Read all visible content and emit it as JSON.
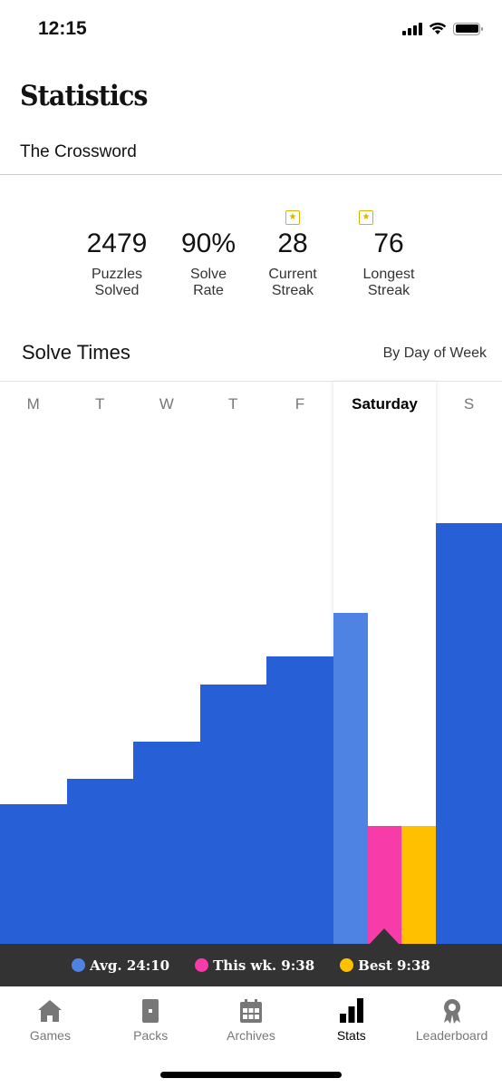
{
  "status_bar": {
    "time": "12:15"
  },
  "header": {
    "title": "Statistics",
    "subtitle": "The Crossword"
  },
  "stats": [
    {
      "value": "2479",
      "label_line1": "Puzzles",
      "label_line2": "Solved",
      "badge": false
    },
    {
      "value": "90%",
      "label_line1": "Solve",
      "label_line2": "Rate",
      "badge": false
    },
    {
      "value": "28",
      "label_line1": "Current",
      "label_line2": "Streak",
      "badge": true,
      "badge_icon": "star-icon"
    },
    {
      "value": "76",
      "label_line1": "Longest",
      "label_line2": "Streak",
      "badge": true,
      "badge_icon": "star-icon"
    }
  ],
  "solve_times": {
    "heading": "Solve Times",
    "view_selector": "By Day of Week"
  },
  "colors": {
    "avg": "#4f83e3",
    "bar": "#2760d6",
    "this_week": "#f73caa",
    "best": "#ffc000",
    "legend_bg": "#333333"
  },
  "chart_data": {
    "type": "bar",
    "title": "Solve Times",
    "subtitle": "By Day of Week",
    "categories": [
      "M",
      "T",
      "W",
      "T",
      "F",
      "Saturday",
      "S"
    ],
    "selected_category": "Saturday",
    "series": [
      {
        "name": "Avg. (relative height)",
        "values": [
          0.248,
          0.293,
          0.36,
          0.461,
          0.511,
          0.588,
          0.748
        ]
      },
      {
        "name": "This wk.",
        "category": "Saturday",
        "value_relative": 0.209,
        "value_label": "9:38"
      },
      {
        "name": "Best",
        "category": "Saturday",
        "value_relative": 0.209,
        "value_label": "9:38"
      }
    ],
    "legend": [
      {
        "label": "Avg. 24:10",
        "color": "#4f83e3"
      },
      {
        "label": "This wk. 9:38",
        "color": "#f73caa"
      },
      {
        "label": "Best 9:38",
        "color": "#ffc000"
      }
    ],
    "legend_position": "bottom"
  },
  "tabbar": {
    "items": [
      {
        "label": "Games",
        "icon": "home-icon",
        "active": false
      },
      {
        "label": "Packs",
        "icon": "pack-icon",
        "active": false
      },
      {
        "label": "Archives",
        "icon": "calendar-icon",
        "active": false
      },
      {
        "label": "Stats",
        "icon": "bar-chart-icon",
        "active": true
      },
      {
        "label": "Leaderboard",
        "icon": "ribbon-icon",
        "active": false
      }
    ]
  }
}
